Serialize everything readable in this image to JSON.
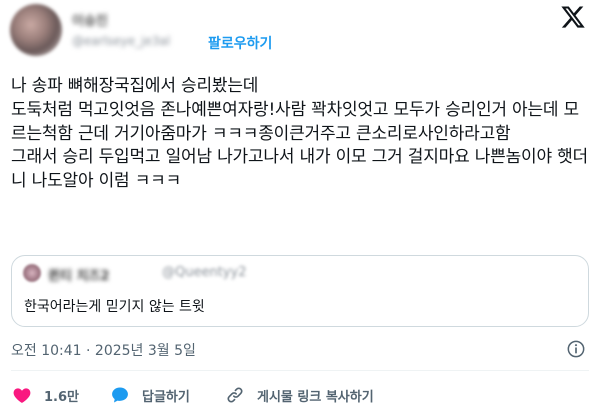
{
  "author": {
    "name": "이승진",
    "handle": "@earlseye_je3al",
    "follow_label": "팔로우하기"
  },
  "tweet": {
    "text": "나 송파 뼈해장국집에서 승리봤는데\n도둑처럼 먹고잇엇음 존나예쁜여자랑!사람 꽉차잇엇고 모두가 승리인거 아는데 모르는척함 근데 거기아줌마가 ㅋㅋㅋ종이큰거주고 큰소리로사인하라고함\n그래서 승리 두입먹고 일어남 나가고나서 내가 이모 그거 걸지마요 나쁜놈이야 햇더니 나도알아 이럼 ㅋㅋㅋ"
  },
  "quote": {
    "name": "퀸티 치즈2",
    "handle": "@Queentyy2",
    "text": "한국어라는게 믿기지 않는 트윗"
  },
  "meta": {
    "timestamp": "오전 10:41 · 2025년 3월 5일"
  },
  "actions": {
    "like_count": "1.6만",
    "reply_label": "답글하기",
    "copy_label": "게시물 링크 복사하기"
  },
  "icons": {
    "logo": "x-logo-icon",
    "info": "info-icon",
    "like": "heart-icon",
    "reply": "reply-bubble-icon",
    "copy": "link-icon"
  },
  "colors": {
    "accent": "#1d9bf0",
    "like": "#f91880",
    "muted": "#536471",
    "text": "#0f1419"
  }
}
